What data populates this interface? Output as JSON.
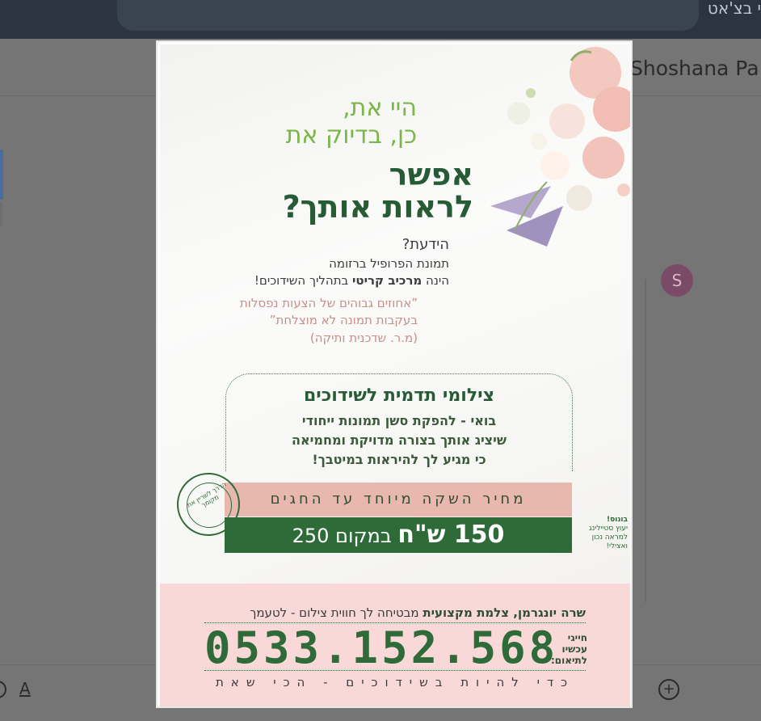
{
  "topbar": {
    "search_text": "י בצ'אט"
  },
  "email": {
    "sender": "Shoshana Paley",
    "avatar_letter": "S"
  },
  "composer": {
    "format_label": "A",
    "add_label": "+"
  },
  "poster": {
    "headline_light": [
      "היי את,",
      "כן, בדיוק את"
    ],
    "headline_dark": [
      "אפשר",
      "לראות אותך?"
    ],
    "did_you_know": "הידעת?",
    "fact_line1": "תמונת הפרופיל ברזומה",
    "fact_line2_prefix": "הינה ",
    "fact_line2_bold": "מרכיב קריטי",
    "fact_line2_suffix": " בתהליך השידוכים!",
    "quote_lines": [
      "”אחוזים גבוהים של הצעות נפסלות",
      "בעקבות תמונה לא מוצלחת”",
      "(מ.ר. שדכנית ותיקה)"
    ],
    "box_title": "צילומי תדמית לשידוכים",
    "box_lines": [
      "בואי - להפקת סשן תמונות ייחודי",
      "שיציג אותך בצורה מדויקת ומחמיאה",
      "כי מגיע לך להיראות במיטבך!"
    ],
    "promo_label": "מחיר השקה מיוחד עד החגים",
    "price_bold": "150 ש\"ח",
    "price_rest": " במקום 250",
    "stamp_text": "הדרך לשריין את מקומך",
    "bonus_title": "בונוס!",
    "bonus_lines": [
      "יעוץ סטיילינג",
      "למראה נכון",
      "ואצילי!"
    ],
    "contact_bold": "שרה יונגרמן, צלמת מקצועית",
    "contact_rest": " מבטיחה לך חווית צילום - לטעמך",
    "call_now": [
      "חייגי",
      "עכשיו",
      "לתיאום:"
    ],
    "phone": "0533.152.568",
    "tagline": "כדי להיות בשידוכים - הכי שאת"
  },
  "colors": {
    "dark_green": "#275b35",
    "light_green": "#7ab648",
    "pink": "#f9d9d8",
    "salmon": "#e8b7ae"
  }
}
